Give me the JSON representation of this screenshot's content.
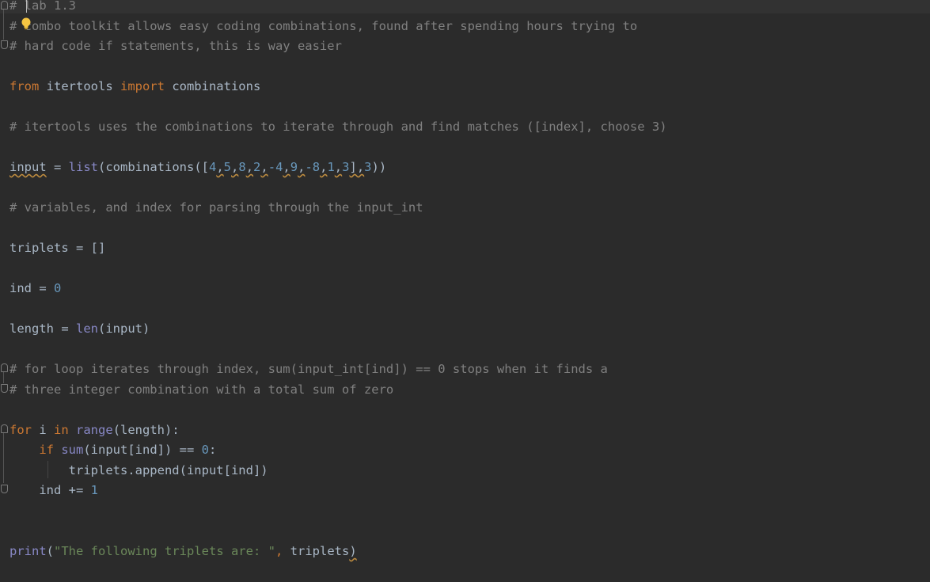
{
  "editor": {
    "language": "python",
    "colors": {
      "background": "#2b2b2b",
      "comment": "#808080",
      "keyword": "#cc7832",
      "builtin": "#8888c6",
      "number": "#6897bb",
      "string": "#6a8759",
      "default": "#a9b7c6",
      "warning_underline": "#c08d3f"
    },
    "icons": [
      "lightbulb-intention-icon",
      "fold-marker-icon"
    ],
    "lines": [
      {
        "text": "# lab 1.3"
      },
      {
        "text": "# combo toolkit allows easy coding combinations, found after spending hours trying to"
      },
      {
        "text": "# hard code if statements, this is way easier"
      },
      {
        "text": ""
      },
      {
        "t1": "from",
        "t2": " itertools ",
        "t3": "import",
        "t4": " combinations"
      },
      {
        "text": ""
      },
      {
        "text": "# itertools uses the combinations to iterate through and find matches ([index], choose 3)"
      },
      {
        "text": ""
      },
      {
        "var": "input",
        "eq": " = ",
        "fn": "list",
        "open": "(combinations([",
        "n": [
          "4",
          "5",
          "8",
          "2",
          "-4",
          "9",
          "-8",
          "1",
          "3"
        ],
        "close1": "],",
        "k": "3",
        "close2": "))"
      },
      {
        "text": ""
      },
      {
        "text": "# variables, and index for parsing through the input_int"
      },
      {
        "text": ""
      },
      {
        "text": "triplets = []"
      },
      {
        "text": ""
      },
      {
        "a": "ind = ",
        "n": "0"
      },
      {
        "text": ""
      },
      {
        "a": "length = ",
        "fn": "len",
        "b": "(input)"
      },
      {
        "text": ""
      },
      {
        "text": "# for loop iterates through index, sum(input_int[ind]) == 0 stops when it finds a"
      },
      {
        "text": "# three integer combination with a total sum of zero"
      },
      {
        "text": ""
      },
      {
        "k1": "for",
        "a": " i ",
        "k2": "in",
        "b": " ",
        "fn": "range",
        "c": "(length):"
      },
      {
        "ind": "    ",
        "k1": "if",
        "b": " ",
        "fn": "sum",
        "c": "(input[ind]) == ",
        "n": "0",
        "d": ":"
      },
      {
        "text": "        triplets.append(input[ind])"
      },
      {
        "a": "    ind += ",
        "n": "1"
      },
      {
        "text": ""
      },
      {
        "text": ""
      },
      {
        "fn": "print",
        "a": "(",
        "s": "\"The following triplets are: \"",
        "k": ",",
        "b": " triplets",
        "c": ")"
      }
    ]
  }
}
